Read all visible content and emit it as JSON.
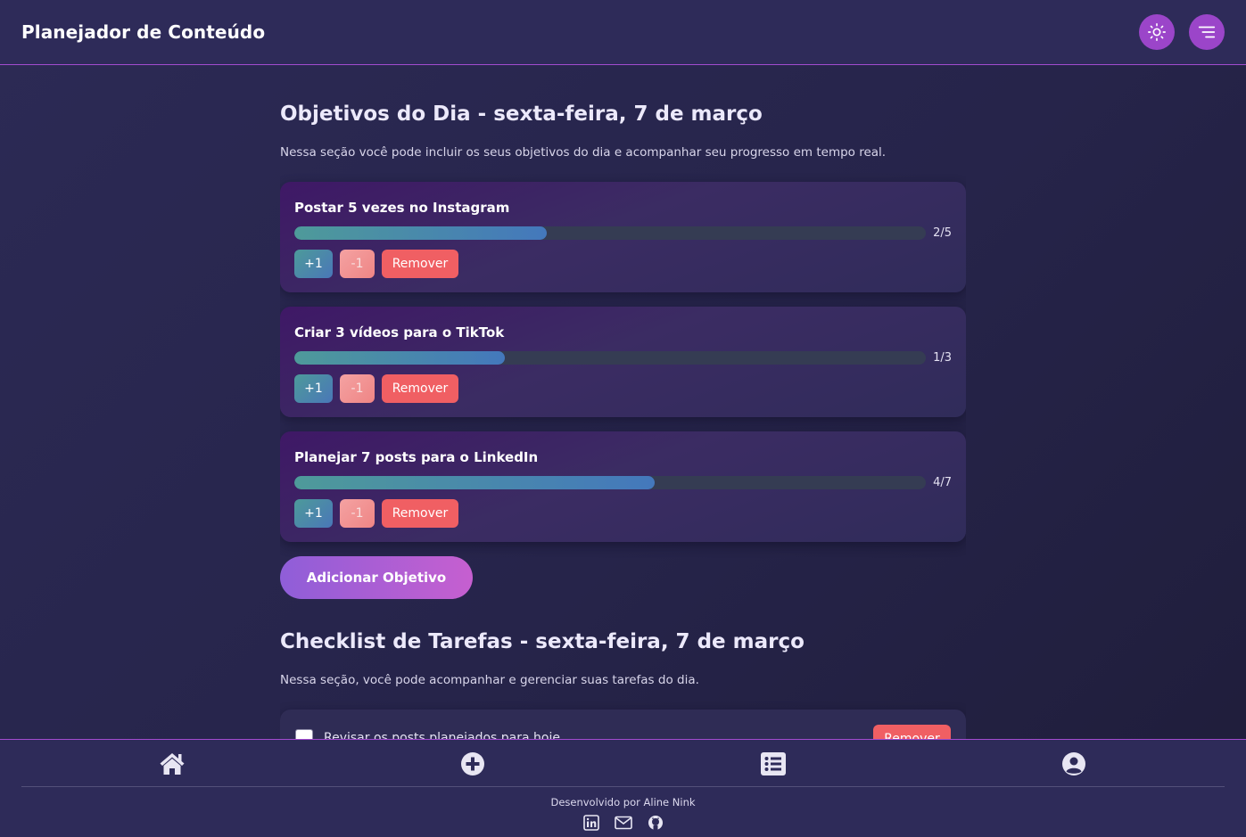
{
  "header": {
    "title": "Planejador de Conteúdo",
    "theme_icon": "sun-icon",
    "menu_icon": "menu-icon"
  },
  "goals_section": {
    "title": "Objetivos do Dia - sexta-feira, 7 de março",
    "description": "Nessa seção você pode incluir os seus objetivos do dia e acompanhar seu progresso em tempo real.",
    "goals": [
      {
        "name": "Postar 5 vezes no Instagram",
        "current": 2,
        "target": 5,
        "count_label": "2/5",
        "progress": 0.4
      },
      {
        "name": "Criar 3 vídeos para o TikTok",
        "current": 1,
        "target": 3,
        "count_label": "1/3",
        "progress": 0.333
      },
      {
        "name": "Planejar 7 posts para o LinkedIn",
        "current": 4,
        "target": 7,
        "count_label": "4/7",
        "progress": 0.571
      }
    ],
    "increment_label": "+1",
    "decrement_label": "-1",
    "remove_label": "Remover",
    "add_button_label": "Adicionar Objetivo"
  },
  "tasks_section": {
    "title": "Checklist de Tarefas - sexta-feira, 7 de março",
    "description": "Nessa seção, você pode acompanhar e gerenciar suas tarefas do dia.",
    "tasks": [
      {
        "label": "Revisar os posts planejados para hoje",
        "checked": false
      }
    ],
    "remove_label": "Remover"
  },
  "bottom_nav": {
    "items": [
      {
        "name": "home",
        "icon": "home-icon"
      },
      {
        "name": "add",
        "icon": "plus-circle-icon"
      },
      {
        "name": "list",
        "icon": "list-icon"
      },
      {
        "name": "profile",
        "icon": "user-circle-icon"
      }
    ]
  },
  "footer": {
    "credit": "Desenvolvido por Aline Nink",
    "social": [
      "linkedin-icon",
      "mail-icon",
      "github-icon"
    ]
  },
  "colors": {
    "accent": "#9b45c9",
    "header_bg": "#2e2b59",
    "progress_start": "#4e9a9a",
    "progress_end": "#4478bc",
    "remove": "#f05f63"
  }
}
